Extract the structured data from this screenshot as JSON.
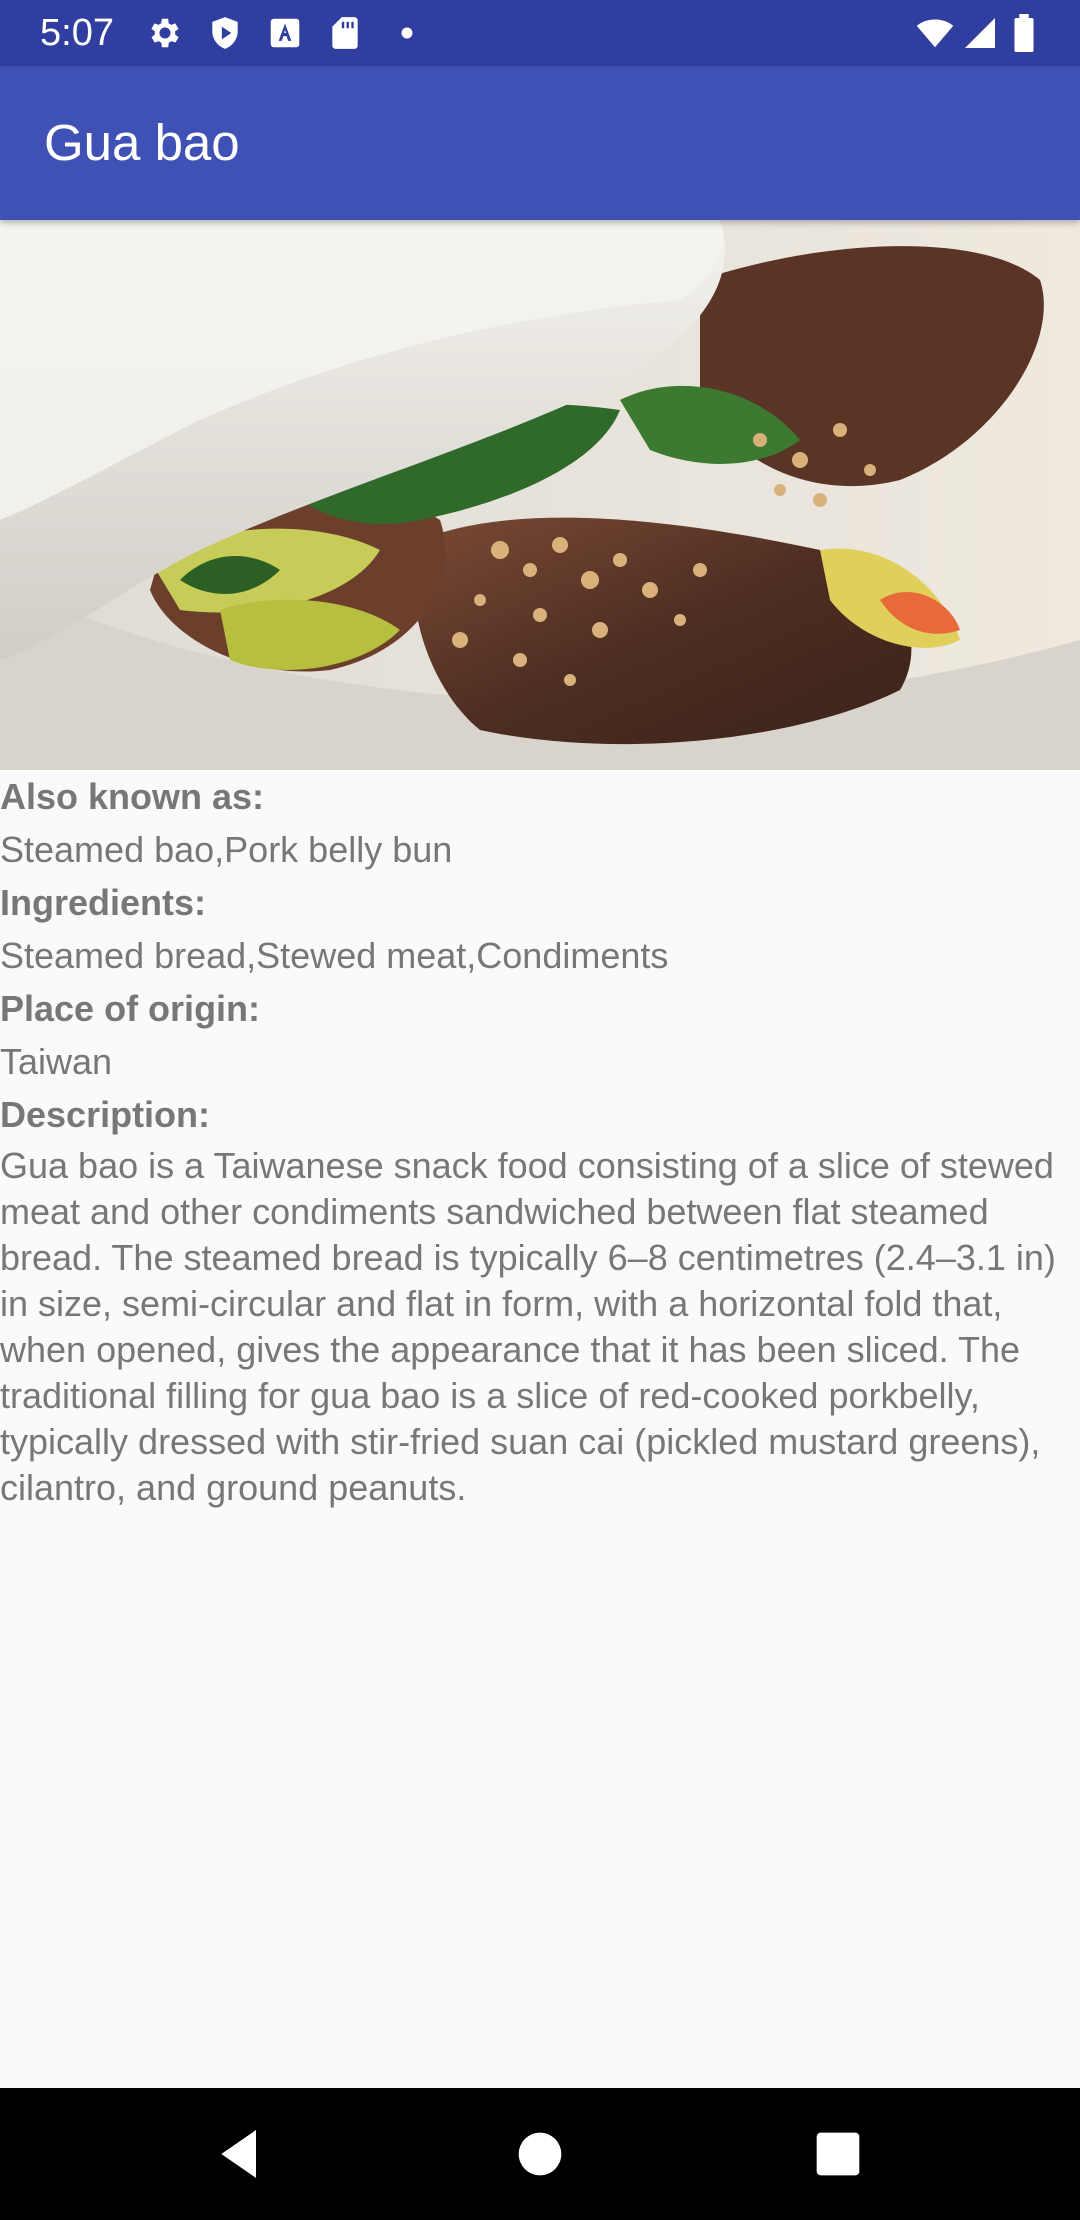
{
  "status_bar": {
    "time": "5:07",
    "icons_left": [
      "gear-icon",
      "shield-play-icon",
      "font-a-icon",
      "sd-card-icon",
      "dot-icon"
    ],
    "icons_right": [
      "wifi-icon",
      "signal-icon",
      "battery-icon"
    ]
  },
  "app_bar": {
    "title": "Gua bao"
  },
  "hero_image": {
    "subject": "gua bao steamed bun photo"
  },
  "details": {
    "also_known_as_label": "Also known as:",
    "also_known_as_value": "Steamed bao,Pork belly bun",
    "ingredients_label": "Ingredients:",
    "ingredients_value": "Steamed bread,Stewed meat,Condiments",
    "place_of_origin_label": "Place of origin:",
    "place_of_origin_value": "Taiwan",
    "description_label": "Description:",
    "description_value": "Gua bao is a Taiwanese snack food consisting of a slice of stewed meat and other condiments sandwiched between flat steamed bread. The steamed bread is typically 6–8 centimetres (2.4–3.1 in) in size, semi-circular and flat in form, with a horizontal fold that, when opened, gives the appearance that it has been sliced. The traditional filling for gua bao is a slice of red-cooked porkbelly, typically dressed with stir-fried suan cai (pickled mustard greens), cilantro, and ground peanuts."
  },
  "nav_bar": {
    "buttons": [
      "back-icon",
      "home-icon",
      "recents-icon"
    ]
  },
  "colors": {
    "status_bar": "#303f9f",
    "app_bar": "#3f51b5",
    "text": "#777777",
    "background": "#fafafa"
  }
}
